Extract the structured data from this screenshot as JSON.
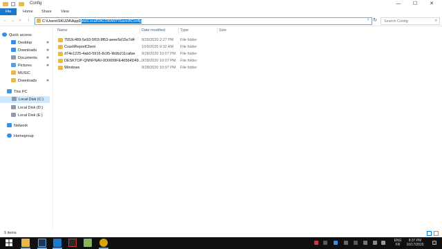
{
  "window": {
    "title": "Config",
    "minimize_glyph": "—",
    "maximize_glyph": "☐",
    "close_glyph": "✕"
  },
  "ribbon": {
    "tabs": [
      "File",
      "Home",
      "Share",
      "View"
    ]
  },
  "address": {
    "path_unselected": "C:\\Users\\SKUZA\\AppD",
    "path_selected": "ata\\Local\\VALORANT\\Saved\\Config",
    "search_placeholder": "Search Config",
    "back_glyph": "←",
    "forward_glyph": "→",
    "recent_glyph": "˅",
    "up_glyph": "↑",
    "dropdown_glyph": "˅",
    "refresh_glyph": "↻",
    "search_glyph": "⌕"
  },
  "columns": {
    "name": "Name",
    "date": "Date modified",
    "type": "Type",
    "size": "Size"
  },
  "files": [
    {
      "name": "7553c489-5e93-5f03-8f53-aeee5d15e7d4",
      "date": "9/29/2020 2:27 PM",
      "type": "File folder"
    },
    {
      "name": "CrashReportClient",
      "date": "10/9/2020 9:32 AM",
      "type": "File folder"
    },
    {
      "name": "d74e1225-4ab0-5916-8c95-9b9b211cafae",
      "date": "9/28/2020 10:07 PM",
      "type": "File folder"
    },
    {
      "name": "DESKTOP-QNNFNAV-0D0699FE46564D49...",
      "date": "9/28/2020 10:07 PM",
      "type": "File folder"
    },
    {
      "name": "Windows",
      "date": "9/28/2020 10:07 PM",
      "type": "File folder"
    }
  ],
  "sidebar": {
    "quick_access": "Quick access",
    "quick_items": [
      {
        "label": "Desktop",
        "icon": "desktop-icon",
        "color": "#3a8ee6"
      },
      {
        "label": "Downloads",
        "icon": "download-icon",
        "color": "#3a8ee6"
      },
      {
        "label": "Documents",
        "icon": "documents-icon",
        "color": "#8a9bb0"
      },
      {
        "label": "Pictures",
        "icon": "pictures-icon",
        "color": "#5aa0d8"
      },
      {
        "label": "MUSIC",
        "icon": "folder-icon",
        "color": "#e6b94a"
      },
      {
        "label": "Downloads",
        "icon": "folder-icon",
        "color": "#e6b94a"
      }
    ],
    "this_pc": "This PC",
    "drives": [
      "Local Disk (C:)",
      "Local Disk (D:)",
      "Local Disk (E:)"
    ],
    "network": "Network",
    "homegroup": "Homegroup",
    "pin_glyph": "✱"
  },
  "status": {
    "count_text": "5 items"
  },
  "taskbar": {
    "tray_lang_top": "ENG",
    "tray_lang_bottom": "FR",
    "time": "8:37 PM",
    "date": "10/17/2020",
    "colors": {
      "bg": "#101010",
      "accent": "#1979ca"
    }
  }
}
